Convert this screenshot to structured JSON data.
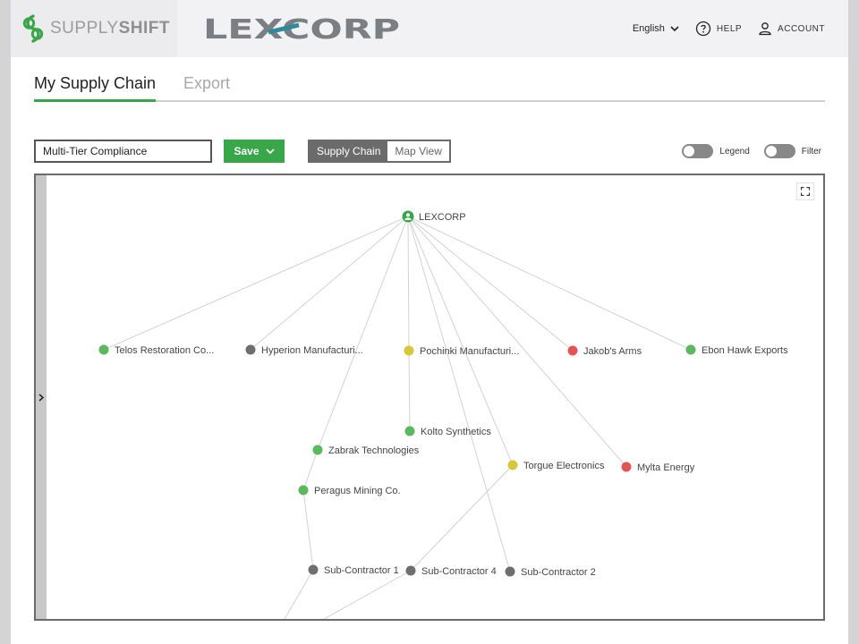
{
  "header": {
    "brand": {
      "light": "SUPPLY",
      "bold": "SHIFT"
    },
    "client_logo": "LEXCORP",
    "language": "English",
    "help_label": "HELP",
    "account_label": "ACCOUNT"
  },
  "tabs": [
    {
      "label": "My Supply Chain",
      "active": true
    },
    {
      "label": "Export",
      "active": false
    }
  ],
  "controls": {
    "chain_name": "Multi-Tier Compliance",
    "save_label": "Save",
    "view_options": [
      "Supply Chain",
      "Map View"
    ],
    "selected_view": "Supply Chain",
    "legend_label": "Legend",
    "legend_on": false,
    "filter_label": "Filter",
    "filter_on": false
  },
  "colors": {
    "accent": "#3aa64a",
    "green": "#5cb85c",
    "gray": "#6e6e70",
    "yellow": "#d8c73a",
    "red": "#e25353",
    "root": "#3aa64a"
  },
  "graph": {
    "root": {
      "label": "LEXCORP",
      "icon": "user-circle-icon"
    },
    "nodes": [
      {
        "id": "telos",
        "label": "Telos Restoration Co...",
        "status": "green"
      },
      {
        "id": "hyperion",
        "label": "Hyperion Manufacturi...",
        "status": "gray"
      },
      {
        "id": "pochinki",
        "label": "Pochinki Manufacturi...",
        "status": "yellow"
      },
      {
        "id": "jakob",
        "label": "Jakob's Arms",
        "status": "red"
      },
      {
        "id": "ebon",
        "label": "Ebon Hawk Exports",
        "status": "green"
      },
      {
        "id": "kolto",
        "label": "Kolto Synthetics",
        "status": "green"
      },
      {
        "id": "zabrak",
        "label": "Zabrak Technologies",
        "status": "green"
      },
      {
        "id": "torgue",
        "label": "Torgue Electronics",
        "status": "yellow"
      },
      {
        "id": "mylta",
        "label": "Mylta Energy",
        "status": "red"
      },
      {
        "id": "peragus",
        "label": "Peragus Mining Co.",
        "status": "green"
      },
      {
        "id": "sub1",
        "label": "Sub-Contractor 1",
        "status": "gray"
      },
      {
        "id": "sub4",
        "label": "Sub-Contractor 4",
        "status": "gray"
      },
      {
        "id": "sub2",
        "label": "Sub-Contractor 2",
        "status": "gray"
      }
    ],
    "edges": [
      [
        "root",
        "telos"
      ],
      [
        "root",
        "hyperion"
      ],
      [
        "root",
        "pochinki"
      ],
      [
        "root",
        "jakob"
      ],
      [
        "root",
        "ebon"
      ],
      [
        "root",
        "zabrak"
      ],
      [
        "root",
        "torgue"
      ],
      [
        "root",
        "mylta"
      ],
      [
        "root",
        "sub2"
      ],
      [
        "pochinki",
        "kolto"
      ],
      [
        "zabrak",
        "peragus"
      ],
      [
        "peragus",
        "sub1"
      ],
      [
        "torgue",
        "sub4"
      ],
      [
        "sub1",
        "offscreen-a"
      ],
      [
        "sub4",
        "offscreen-b"
      ]
    ]
  }
}
